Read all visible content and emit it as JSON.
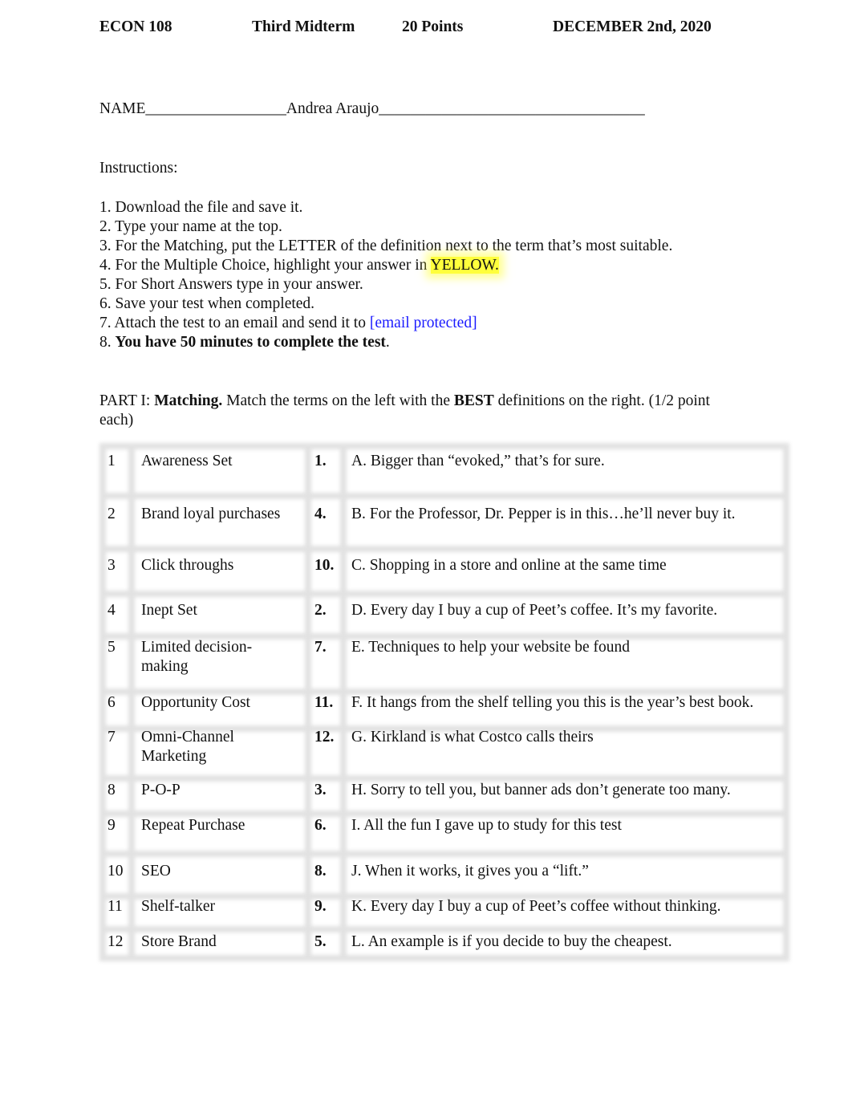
{
  "header": {
    "course": "ECON 108",
    "exam": "Third Midterm",
    "points": "20 Points",
    "date": "DECEMBER 2nd, 2020"
  },
  "name_line": {
    "label": "NAME",
    "blank_before": "__________________",
    "value": "Andrea Araujo",
    "blank_after": "__________________________________"
  },
  "instructions": {
    "heading": "Instructions:",
    "items": [
      "1. Download the file and save it.",
      "2. Type your name at the top.",
      "3. For the Matching, put the LETTER of the definition next to the term that’s most suitable.",
      "4. For the Multiple Choice, highlight your answer in ",
      "5. For Short Answers type in your answer.",
      "6. Save your test when completed.",
      "7. Attach the test to an email and send it to ",
      "8. "
    ],
    "item4_highlight": "YELLOW.",
    "item7_link": "[email protected]",
    "item8_bold": "You have 50 minutes to complete the test",
    "item8_end": "."
  },
  "part1": {
    "prefix": "PART I: ",
    "title_bold": "Matching.",
    "text1": " Match the terms on the left with the ",
    "best_bold": "BEST",
    "text2": " definitions on the right. (1/2 point",
    "text3": "each)"
  },
  "matching_table": {
    "rows": [
      {
        "num": "1",
        "term": [
          "Awareness Set"
        ],
        "answer": "1.",
        "definition": "A. Bigger than “evoked,” that’s for sure."
      },
      {
        "num": "2",
        "term": [
          "Brand loyal purchases"
        ],
        "answer": "4.",
        "definition": "B.  For the Professor, Dr. Pepper is in this…he’ll never buy it."
      },
      {
        "num": "3",
        "term": [
          "Click throughs"
        ],
        "answer": "10.",
        "definition": "C. Shopping in a store and online at the same time"
      },
      {
        "num": "4",
        "term": [
          "Inept Set"
        ],
        "answer": "2.",
        "definition": "D. Every day I buy a cup of Peet’s coffee. It’s my favorite."
      },
      {
        "num": "5",
        "term": [
          "Limited decision-",
          "making"
        ],
        "answer": "7.",
        "definition": "E. Techniques to help your website be found"
      },
      {
        "num": "6",
        "term": [
          "Opportunity Cost"
        ],
        "answer": "11.",
        "definition": "F. It hangs from the shelf telling you this is the year’s best book."
      },
      {
        "num": "7",
        "term": [
          "Omni-Channel",
          "Marketing"
        ],
        "answer": "12.",
        "definition": "G. Kirkland is what Costco calls theirs"
      },
      {
        "num": "8",
        "term": [
          "P-O-P"
        ],
        "answer": "3.",
        "definition": "H. Sorry to tell you, but banner ads don’t generate too many."
      },
      {
        "num": "9",
        "term": [
          "Repeat Purchase"
        ],
        "answer": "6.",
        "definition": "I. All the fun I gave up to study for this test"
      },
      {
        "num": "10",
        "term": [
          "SEO"
        ],
        "answer": "8.",
        "definition": "J. When it works, it gives you a “lift.”"
      },
      {
        "num": "11",
        "term": [
          "Shelf-talker"
        ],
        "answer": "9.",
        "definition": "K. Every day I buy a cup of Peet’s coffee without thinking."
      },
      {
        "num": "12",
        "term": [
          "Store Brand"
        ],
        "answer": "5.",
        "definition": "L. An example is if you decide to buy the cheapest."
      }
    ]
  }
}
